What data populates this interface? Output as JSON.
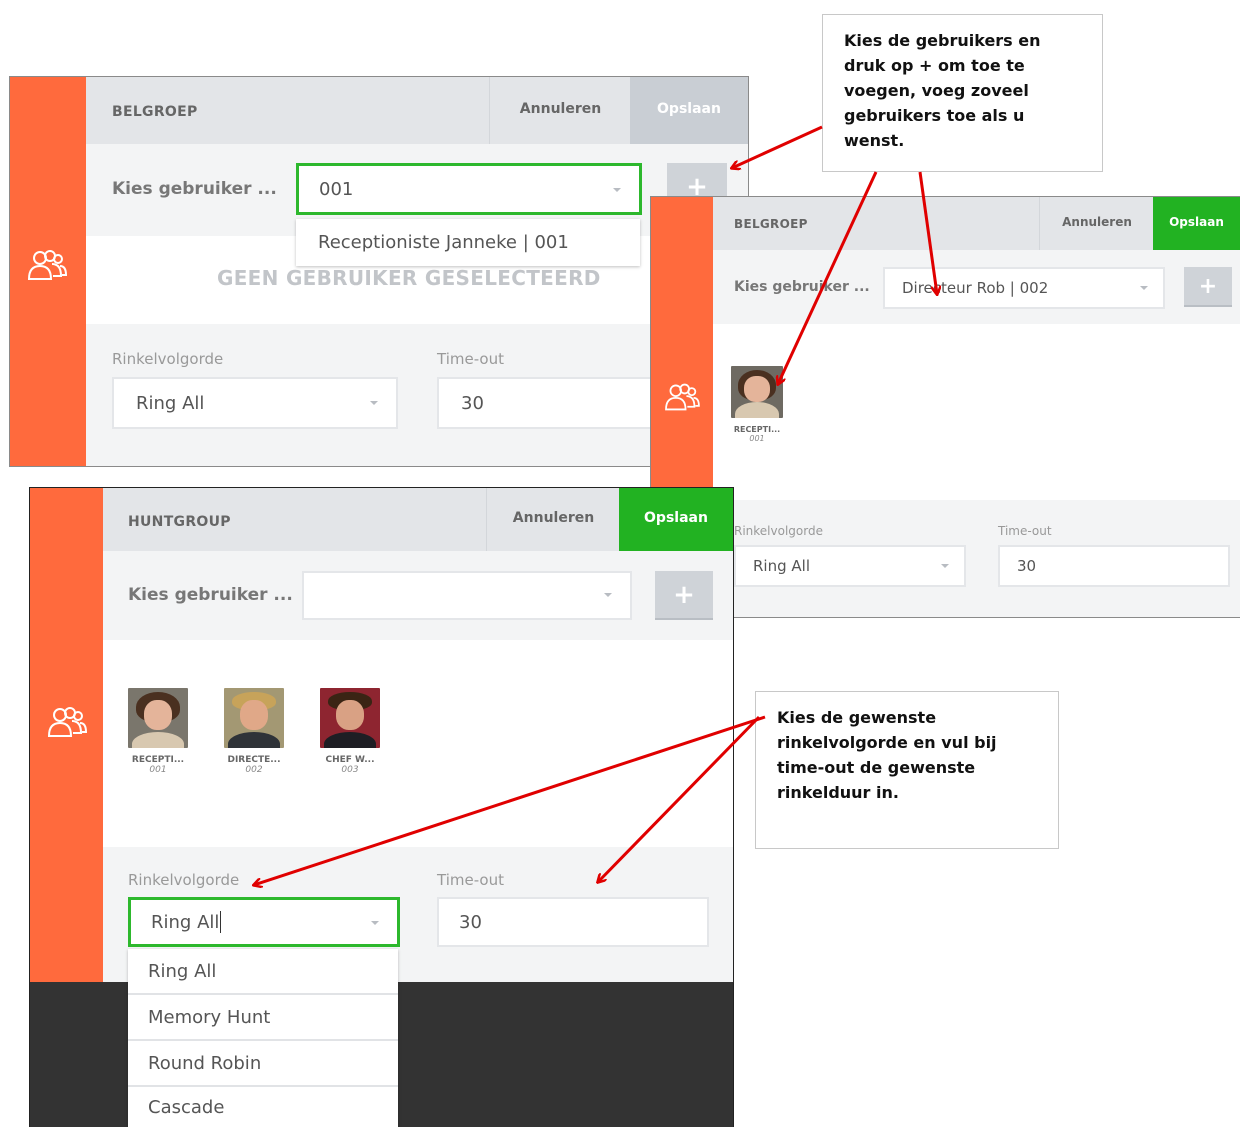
{
  "icons": {
    "group": "users-group-icon",
    "plus": "plus-icon",
    "caret": "chevron-down-icon"
  },
  "colors": {
    "accent": "#ff6a3d",
    "save_active": "#22b222",
    "save_disabled": "#c9ced4",
    "highlight": "#2db82d",
    "arrow": "#e00000"
  },
  "panel1": {
    "title": "BELGROEP",
    "cancel_label": "Annuleren",
    "save_label": "Opslaan",
    "choose_user_label": "Kies gebruiker ...",
    "user_select_value": "001",
    "suggestion": "Receptioniste Janneke | 001",
    "empty_state": "GEEN GEBRUIKER GESELECTEERD",
    "ring_order_label": "Rinkelvolgorde",
    "ring_order_value": "Ring All",
    "timeout_label": "Time-out",
    "timeout_value": "30"
  },
  "panel2": {
    "title": "BELGROEP",
    "cancel_label": "Annuleren",
    "save_label": "Opslaan",
    "choose_user_label": "Kies gebruiker ...",
    "user_select_value": "Directeur Rob | 002",
    "members": [
      {
        "name": "RECEPTI...",
        "number": "001"
      }
    ],
    "ring_order_label": "Rinkelvolgorde",
    "ring_order_value": "Ring All",
    "timeout_label": "Time-out",
    "timeout_value": "30"
  },
  "panel3": {
    "title": "HUNTGROUP",
    "cancel_label": "Annuleren",
    "save_label": "Opslaan",
    "choose_user_label": "Kies gebruiker ...",
    "user_select_value": "",
    "members": [
      {
        "name": "RECEPTI...",
        "number": "001"
      },
      {
        "name": "DIRECTE...",
        "number": "002"
      },
      {
        "name": "CHEF W...",
        "number": "003"
      }
    ],
    "ring_order_label": "Rinkelvolgorde",
    "ring_order_value": "Ring All",
    "timeout_label": "Time-out",
    "timeout_value": "30",
    "ring_options": [
      "Ring All",
      "Memory Hunt",
      "Round Robin",
      "Cascade"
    ]
  },
  "callouts": {
    "top": "Kies de gebruikers en druk op + om toe te voegen, voeg zoveel gebruikers toe als u wenst.",
    "bottom": "Kies de gewenste rinkelvolgorde en vul bij time-out de gewenste rinkelduur in."
  }
}
